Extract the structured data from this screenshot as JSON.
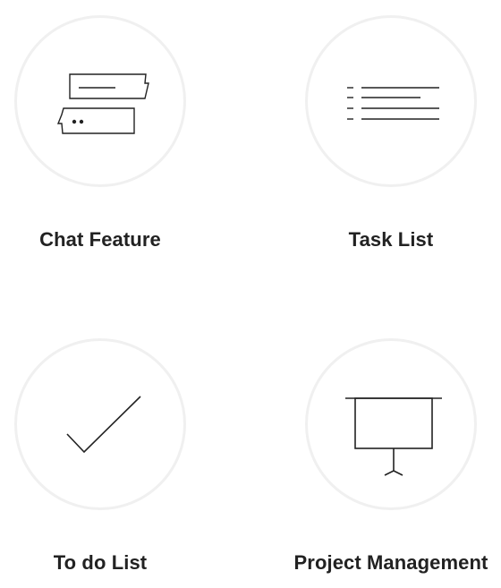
{
  "features": [
    {
      "label": "Chat Feature",
      "icon": "chat-bubbles-icon"
    },
    {
      "label": "Task List",
      "icon": "task-list-icon"
    },
    {
      "label": "To do List",
      "icon": "checkmark-icon"
    },
    {
      "label": "Project Management",
      "icon": "projector-screen-icon"
    }
  ],
  "colors": {
    "circle_border": "#f0f0f0",
    "icon_stroke": "#222222",
    "label_text": "#222222",
    "background": "#ffffff"
  }
}
